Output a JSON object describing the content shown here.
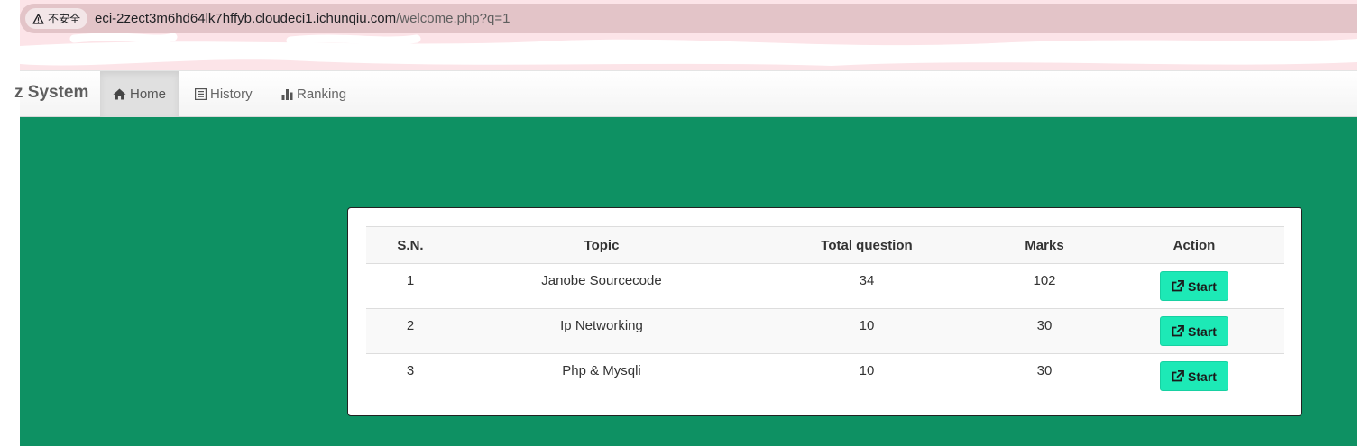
{
  "browser": {
    "security_label": "不安全",
    "url_host": "eci-2zect3m6hd64lk7hffyb.cloudeci1.ichunqiu.com",
    "url_path": "/welcome.php?q=1"
  },
  "navbar": {
    "brand": "z System",
    "items": [
      {
        "label": "Home",
        "icon": "home-icon",
        "active": true
      },
      {
        "label": "History",
        "icon": "list-icon",
        "active": false
      },
      {
        "label": "Ranking",
        "icon": "bar-chart-icon",
        "active": false
      }
    ]
  },
  "table": {
    "headers": [
      "S.N.",
      "Topic",
      "Total question",
      "Marks",
      "Action"
    ],
    "rows": [
      {
        "sn": "1",
        "topic": "Janobe Sourcecode",
        "total": "34",
        "marks": "102",
        "action": "Start"
      },
      {
        "sn": "2",
        "topic": "Ip Networking",
        "total": "10",
        "marks": "30",
        "action": "Start"
      },
      {
        "sn": "3",
        "topic": "Php & Mysqli",
        "total": "10",
        "marks": "30",
        "action": "Start"
      }
    ]
  },
  "colors": {
    "main_bg": "#0e9163",
    "button_bg": "#1de9b6",
    "address_bar": "#e3c4c8"
  }
}
